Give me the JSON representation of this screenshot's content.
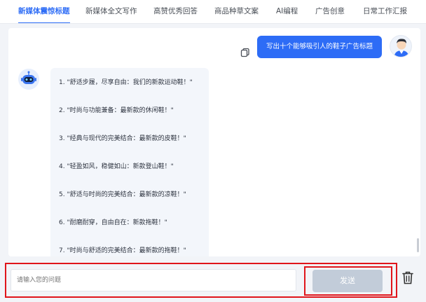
{
  "tabs": [
    {
      "label": "新媒体震惊标题",
      "active": true
    },
    {
      "label": "新媒体全文写作",
      "active": false
    },
    {
      "label": "高赞优秀回答",
      "active": false
    },
    {
      "label": "商品种草文案",
      "active": false
    },
    {
      "label": "AI编程",
      "active": false
    },
    {
      "label": "广告创意",
      "active": false
    },
    {
      "label": "日常工作汇报",
      "active": false
    }
  ],
  "chat": {
    "user_message": "写出十个能够吸引人的鞋子广告标题",
    "bot_lines": [
      "1. \"舒适步履，尽享自由：我们的新款运动鞋！\"",
      "2. \"时尚与功能兼备：最新款的休闲鞋！\"",
      "3. \"经典与现代的完美结合：最新款的皮鞋！\"",
      "4. \"轻盈如风，稳健如山：新款登山鞋！\"",
      "5. \"舒适与时尚的完美结合：最新款的凉鞋！\"",
      "6. \"耐磨耐穿，自由自在：新款拖鞋！\"",
      "7. \"时尚与舒适的完美结合：最新款的拖鞋！\""
    ],
    "icons": {
      "user": "user-avatar-icon",
      "bot": "robot-avatar-icon",
      "copy": "copy-icon"
    }
  },
  "composer": {
    "placeholder": "请输入您的问题",
    "send_label": "发送",
    "delete_icon": "trash-icon"
  },
  "colors": {
    "accent": "#2d6cf6",
    "highlight_border": "#e0151b",
    "send_disabled": "#c2ccd9"
  }
}
